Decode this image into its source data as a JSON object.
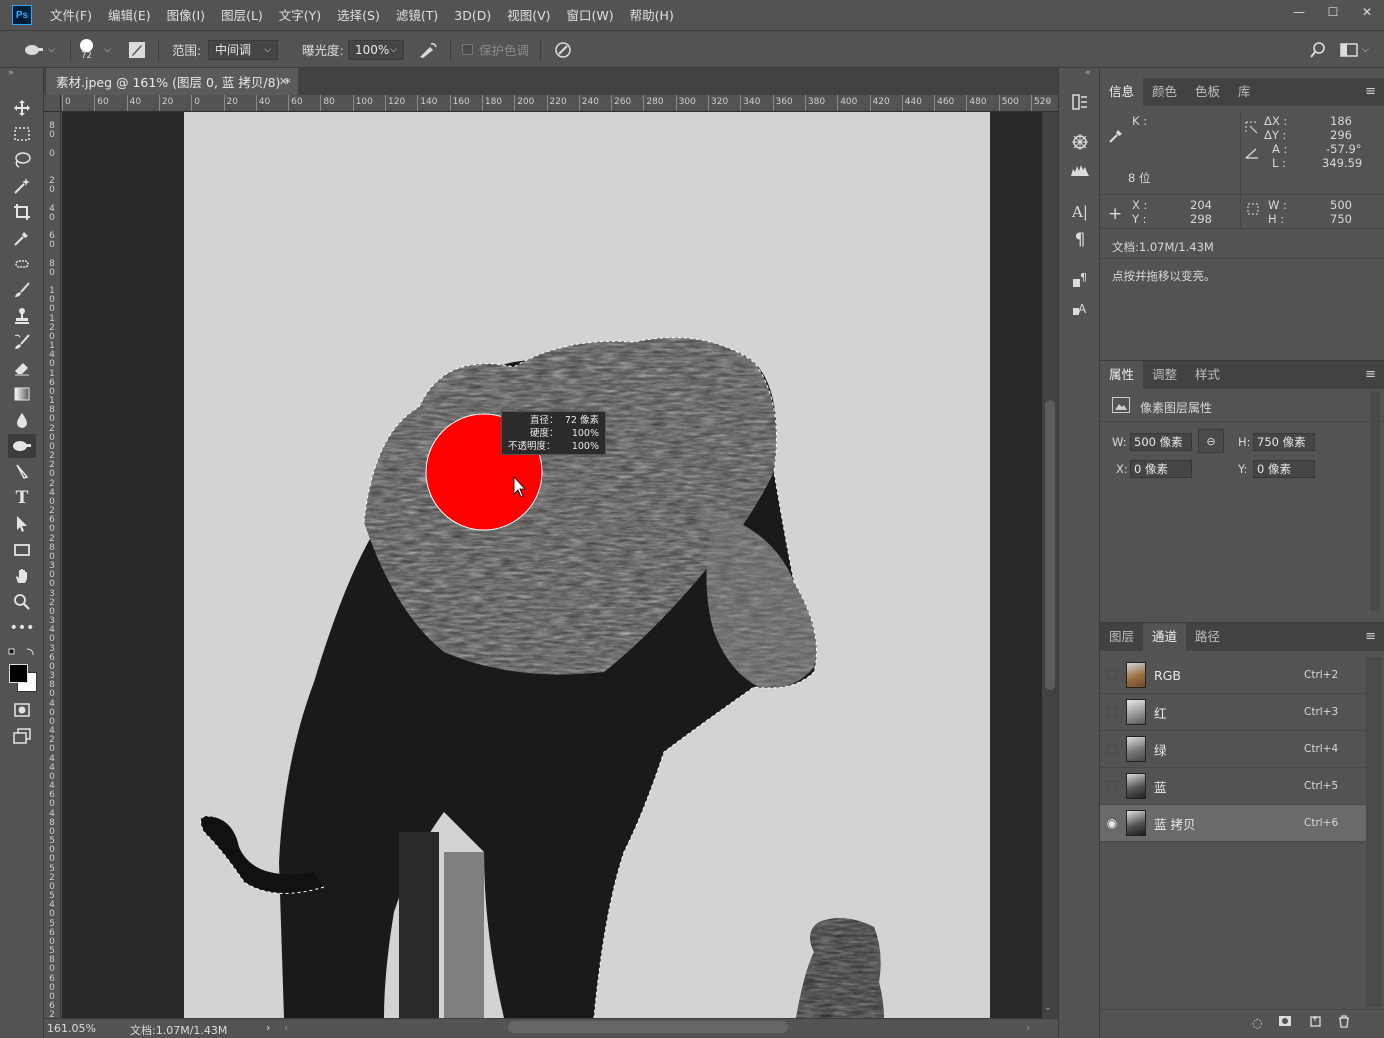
{
  "app": {
    "logo": "Ps"
  },
  "menu": [
    "文件(F)",
    "编辑(E)",
    "图像(I)",
    "图层(L)",
    "文字(Y)",
    "选择(S)",
    "滤镜(T)",
    "3D(D)",
    "视图(V)",
    "窗口(W)",
    "帮助(H)"
  ],
  "window_controls": {
    "minimize": "—",
    "maximize": "☐",
    "close": "✕"
  },
  "options": {
    "brush_size": "72",
    "range_label": "范围:",
    "range_value": "中间调",
    "exposure_label": "曝光度:",
    "exposure_value": "100%",
    "protect_tones": "保护色调"
  },
  "document": {
    "tab_title": "素材.jpeg @ 161% (图层 0, 蓝 拷贝/8) *",
    "close": "✕"
  },
  "ruler": {
    "h_ticks": [
      "0",
      "60",
      "40",
      "20",
      "0",
      "20",
      "40",
      "60",
      "80",
      "100",
      "120",
      "140",
      "160",
      "180",
      "200",
      "220",
      "240",
      "260",
      "280",
      "300",
      "320",
      "340",
      "360",
      "380",
      "400",
      "420",
      "440",
      "460",
      "480",
      "500",
      "520"
    ],
    "v_ticks": [
      "80",
      "0",
      "20",
      "40",
      "60",
      "80",
      "100",
      "120",
      "140",
      "160",
      "180",
      "200",
      "220",
      "240",
      "260",
      "280",
      "300",
      "320",
      "340",
      "360",
      "380",
      "400",
      "420",
      "440",
      "460",
      "480",
      "500",
      "520",
      "540",
      "560",
      "580",
      "600",
      "620"
    ]
  },
  "brush_tooltip": {
    "diameter_label": "直径：",
    "diameter_value": "72 像素",
    "hardness_label": "硬度：",
    "hardness_value": "100%",
    "opacity_label": "不透明度：",
    "opacity_value": "100%"
  },
  "status": {
    "zoom": "161.05%",
    "doc": "文档:1.07M/1.43M"
  },
  "info_panel": {
    "tabs": [
      "信息",
      "颜色",
      "色板",
      "库"
    ],
    "k_label": "K :",
    "bits": "8 位",
    "dx_label": "ΔX :",
    "dx": "186",
    "dy_label": "ΔY :",
    "dy": "296",
    "a_label": "A :",
    "a": "-57.9°",
    "l_label": "L :",
    "l": "349.59",
    "x_label": "X :",
    "x": "204",
    "y_label": "Y :",
    "y": "298",
    "w_label": "W :",
    "w": "500",
    "h_label": "H :",
    "h": "750",
    "doc": "文档:1.07M/1.43M",
    "hint": "点按并拖移以变亮。"
  },
  "properties_panel": {
    "tabs": [
      "属性",
      "调整",
      "样式"
    ],
    "title": "像素图层属性",
    "w_label": "W:",
    "w_value": "500 像素",
    "h_label": "H:",
    "h_value": "750 像素",
    "x_label": "X:",
    "x_value": "0 像素",
    "y_label": "Y:",
    "y_value": "0 像素"
  },
  "channels_panel": {
    "tabs": [
      "图层",
      "通道",
      "路径"
    ],
    "channels": [
      {
        "name": "RGB",
        "key": "Ctrl+2"
      },
      {
        "name": "红",
        "key": "Ctrl+3"
      },
      {
        "name": "绿",
        "key": "Ctrl+4"
      },
      {
        "name": "蓝",
        "key": "Ctrl+5"
      },
      {
        "name": "蓝 拷贝",
        "key": "Ctrl+6"
      }
    ]
  },
  "colors": {
    "brush_cursor": "#ff0000",
    "accent": "#31a8ff"
  }
}
